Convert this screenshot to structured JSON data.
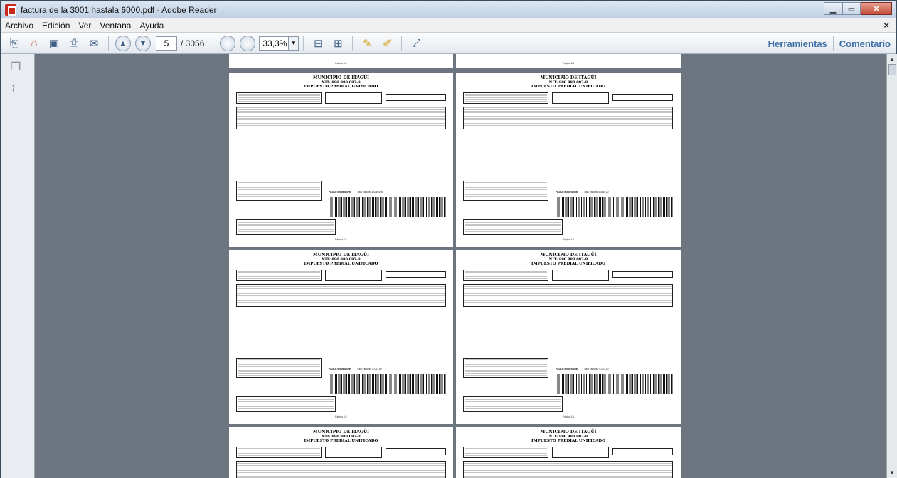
{
  "window": {
    "title": "factura de la 3001 hastala 6000.pdf - Adobe Reader"
  },
  "menu": {
    "items": [
      "Archivo",
      "Edición",
      "Ver",
      "Ventana",
      "Ayuda"
    ]
  },
  "toolbar": {
    "current_page": "5",
    "page_total": "/ 3056",
    "zoom": "33,3%",
    "tools_link": "Herramientas",
    "comment_link": "Comentario"
  },
  "document": {
    "municipio": "MUNICIPIO DE ITAGÜÍ",
    "nit": "NIT: 890.980.093-8",
    "impuesto": "IMPUESTO PREDIAL UNIFICADO",
    "pago_trimestre": "PAGO TRIMESTRE",
    "pagina": "Página 1/1",
    "top_footer_page": "Página 1/1",
    "pages": [
      {
        "total": "Total Factura: 103.354,00",
        "pagina": "Página 1/1"
      },
      {
        "total": "Total Factura: 45.684,00",
        "pagina": "Página 1/1"
      },
      {
        "total": "Total Factura: 71.001,00",
        "pagina": "Página 1/1"
      },
      {
        "total": "Total Factura: 71.001,00",
        "pagina": "Página 1/1"
      }
    ]
  }
}
